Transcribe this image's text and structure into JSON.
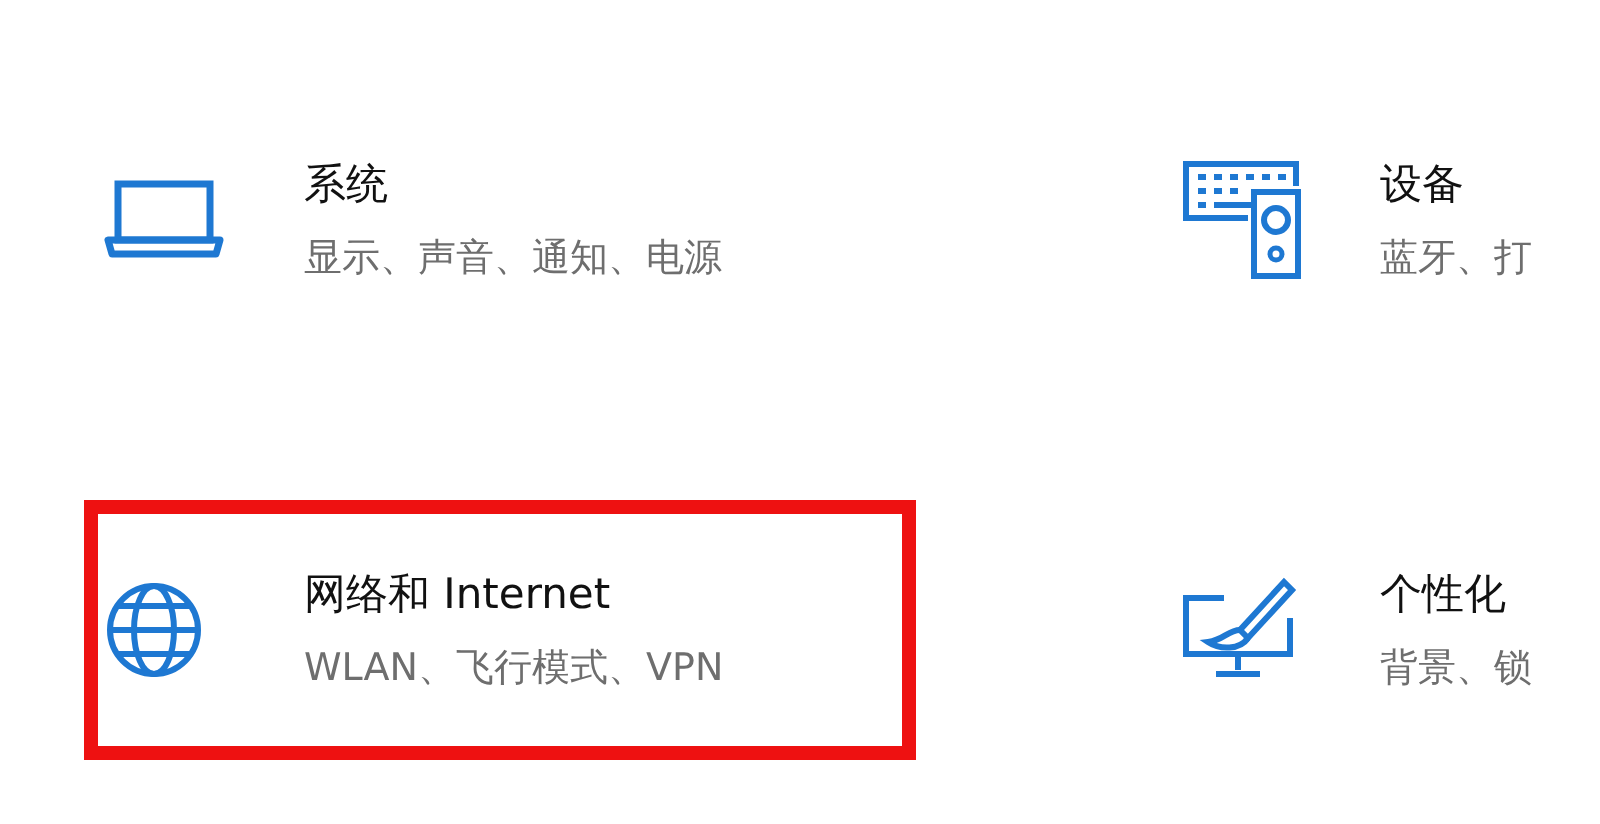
{
  "categories": [
    {
      "kind": "laptop",
      "title": "系统",
      "subtitle": "显示、声音、通知、电源",
      "highlighted": false
    },
    {
      "kind": "devices",
      "title": "设备",
      "subtitle": "蓝牙、打",
      "highlighted": false
    },
    {
      "kind": "globe",
      "title": "网络和 Internet",
      "subtitle": "WLAN、飞行模式、VPN",
      "highlighted": true
    },
    {
      "kind": "personalize",
      "title": "个性化",
      "subtitle": "背景、锁",
      "highlighted": false
    }
  ]
}
